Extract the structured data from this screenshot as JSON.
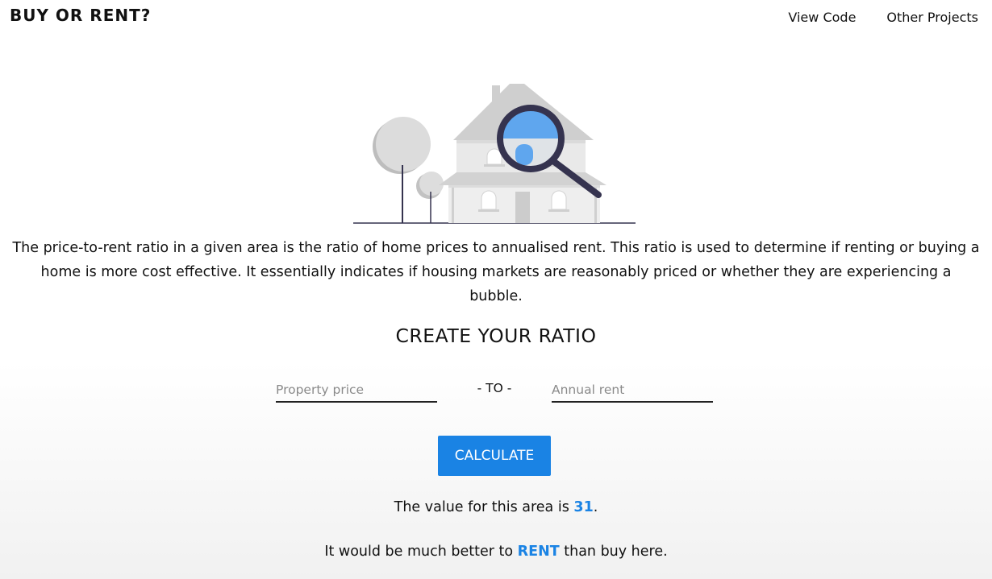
{
  "header": {
    "logo": "BUY OR RENT?",
    "nav": [
      {
        "label": "View Code"
      },
      {
        "label": "Other Projects"
      }
    ]
  },
  "illustration": {
    "icon": "house-search-illustration",
    "colors": {
      "house": "#d7d7d7",
      "roof": "#cfcfcf",
      "lens_fill": "#5fa6ee",
      "lens_frame": "#35334f",
      "tree": "#d6d6d6",
      "trunk": "#35334f"
    }
  },
  "intro": {
    "text": "The price-to-rent ratio in a given area is the ratio of home prices to annualised rent. This ratio is used to determine if renting or buying a home is more cost effective. It essentially indicates if housing markets are reasonably priced or whether they are experiencing a bubble."
  },
  "form": {
    "title": "CREATE YOUR RATIO",
    "price_placeholder": "Property price",
    "price_value": "",
    "separator": "- TO -",
    "rent_placeholder": "Annual rent",
    "rent_value": "",
    "button_label": "CALCULATE"
  },
  "result": {
    "prefix": "The value for this area is ",
    "value": "31",
    "suffix": ".",
    "advice_prefix": "It would be much better to ",
    "advice": "RENT",
    "advice_suffix": " than buy here."
  },
  "colors": {
    "accent": "#1a83e4",
    "text": "#111111"
  }
}
